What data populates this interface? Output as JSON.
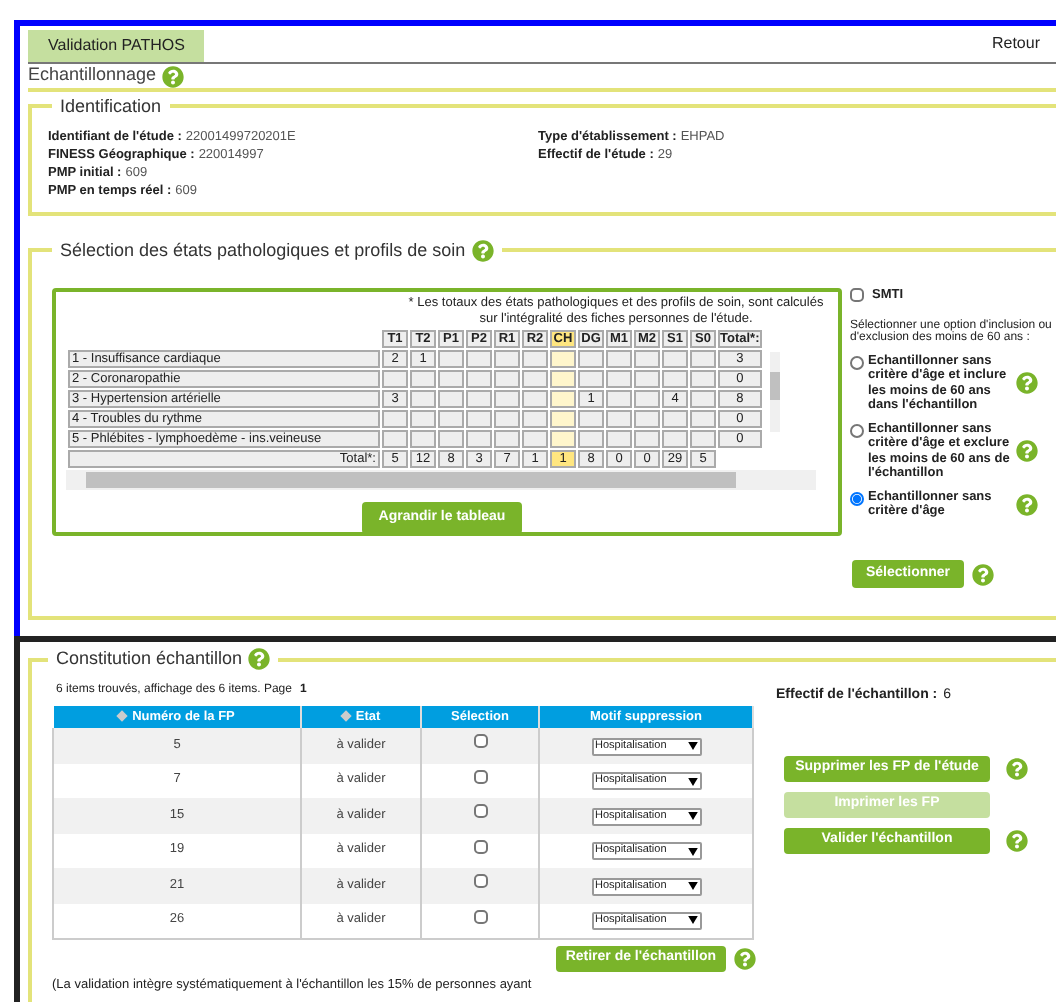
{
  "tabs": [
    {
      "label": "Validation PATHOS",
      "selected": true
    }
  ],
  "return_link": "Retour",
  "page_title": "Echantillonnage",
  "identification": {
    "title": "Identification",
    "fields_left": [
      {
        "label": "Identifiant de l'étude :",
        "value": "22001499720201E"
      },
      {
        "label": "FINESS Géographique :",
        "value": "220014997"
      },
      {
        "label": "PMP initial :",
        "value": "609"
      },
      {
        "label": "PMP en temps réel :",
        "value": "609"
      }
    ],
    "fields_right": [
      {
        "label": "Type d'établissement :",
        "value": "EHPAD"
      },
      {
        "label": "Effectif de l'étude :",
        "value": "29"
      }
    ]
  },
  "selection": {
    "title": "Sélection des états pathologiques et profils de soin",
    "note": "* Les totaux des états pathologiques et des profils de soin, sont calculés sur l'intégralité des fiches personnes de l'étude.",
    "columns": [
      {
        "label": "T1",
        "selected": false
      },
      {
        "label": "T2",
        "selected": false
      },
      {
        "label": "P1",
        "selected": false
      },
      {
        "label": "P2",
        "selected": false
      },
      {
        "label": "R1",
        "selected": false
      },
      {
        "label": "R2",
        "selected": false
      },
      {
        "label": "CH",
        "selected": true
      },
      {
        "label": "DG",
        "selected": false
      },
      {
        "label": "M1",
        "selected": false
      },
      {
        "label": "M2",
        "selected": false
      },
      {
        "label": "S1",
        "selected": false
      },
      {
        "label": "S0",
        "selected": false
      }
    ],
    "total_column": "Total*:",
    "rows": [
      {
        "label": "1 - Insuffisance cardiaque",
        "cells": [
          "2",
          "1",
          null,
          null,
          null,
          null,
          null,
          null,
          null,
          null,
          null,
          null
        ],
        "total": "3"
      },
      {
        "label": "2 - Coronaropathie",
        "cells": [
          null,
          null,
          null,
          null,
          null,
          null,
          null,
          null,
          null,
          null,
          null,
          null
        ],
        "total": "0"
      },
      {
        "label": "3 - Hypertension artérielle",
        "cells": [
          "3",
          null,
          null,
          null,
          null,
          null,
          null,
          "1",
          null,
          null,
          "4",
          null
        ],
        "total": "8"
      },
      {
        "label": "4 - Troubles du rythme",
        "cells": [
          null,
          null,
          null,
          null,
          null,
          null,
          null,
          null,
          null,
          null,
          null,
          null
        ],
        "total": "0"
      },
      {
        "label": "5 - Phlébites - lymphoedème - ins.veineuse",
        "cells": [
          null,
          null,
          null,
          null,
          null,
          null,
          null,
          null,
          null,
          null,
          null,
          null
        ],
        "total": "0"
      }
    ],
    "totals_label": "Total*:",
    "totals": [
      "5",
      "12",
      "8",
      "3",
      "7",
      "1",
      "1",
      "8",
      "0",
      "0",
      "29",
      "5"
    ],
    "expand_button": "Agrandir le tableau",
    "smti": {
      "label": "SMTI",
      "checked": false
    },
    "option_prompt": "Sélectionner une option d'inclusion ou d'exclusion des moins de 60 ans :",
    "options": [
      {
        "label": "Echantillonner sans critère d'âge et inclure les moins de 60 ans dans l'échantillon",
        "selected": false
      },
      {
        "label": "Echantillonner sans critère d'âge et exclure les moins de 60 ans de l'échantillon",
        "selected": false
      },
      {
        "label": "Echantillonner sans critère d'âge",
        "selected": true
      }
    ],
    "select_button": "Sélectionner"
  },
  "sample": {
    "title": "Constitution échantillon",
    "info": "6 items trouvés, affichage des 6 items. Page",
    "page": "1",
    "effectif_label": "Effectif de l'échantillon :",
    "effectif_value": "6",
    "columns": [
      {
        "label": "Numéro de la FP",
        "sortable": true
      },
      {
        "label": "Etat",
        "sortable": true
      },
      {
        "label": "Sélection",
        "sortable": false
      },
      {
        "label": "Motif suppression",
        "sortable": false
      }
    ],
    "rows": [
      {
        "number": "5",
        "state": "à valider",
        "checked": false,
        "reason": "Hospitalisation"
      },
      {
        "number": "7",
        "state": "à valider",
        "checked": false,
        "reason": "Hospitalisation"
      },
      {
        "number": "15",
        "state": "à valider",
        "checked": false,
        "reason": "Hospitalisation"
      },
      {
        "number": "19",
        "state": "à valider",
        "checked": false,
        "reason": "Hospitalisation"
      },
      {
        "number": "21",
        "state": "à valider",
        "checked": false,
        "reason": "Hospitalisation"
      },
      {
        "number": "26",
        "state": "à valider",
        "checked": false,
        "reason": "Hospitalisation"
      }
    ],
    "buttons": [
      {
        "label": "Supprimer les FP de l'étude",
        "disabled": false,
        "help": true
      },
      {
        "label": "Imprimer les FP",
        "disabled": true,
        "help": false
      },
      {
        "label": "Valider l'échantillon",
        "disabled": false,
        "help": true
      }
    ],
    "remove_button": "Retirer de l'échantillon",
    "footnote": "(La validation intègre systématiquement à l'échantillon les 15% de personnes ayant"
  }
}
